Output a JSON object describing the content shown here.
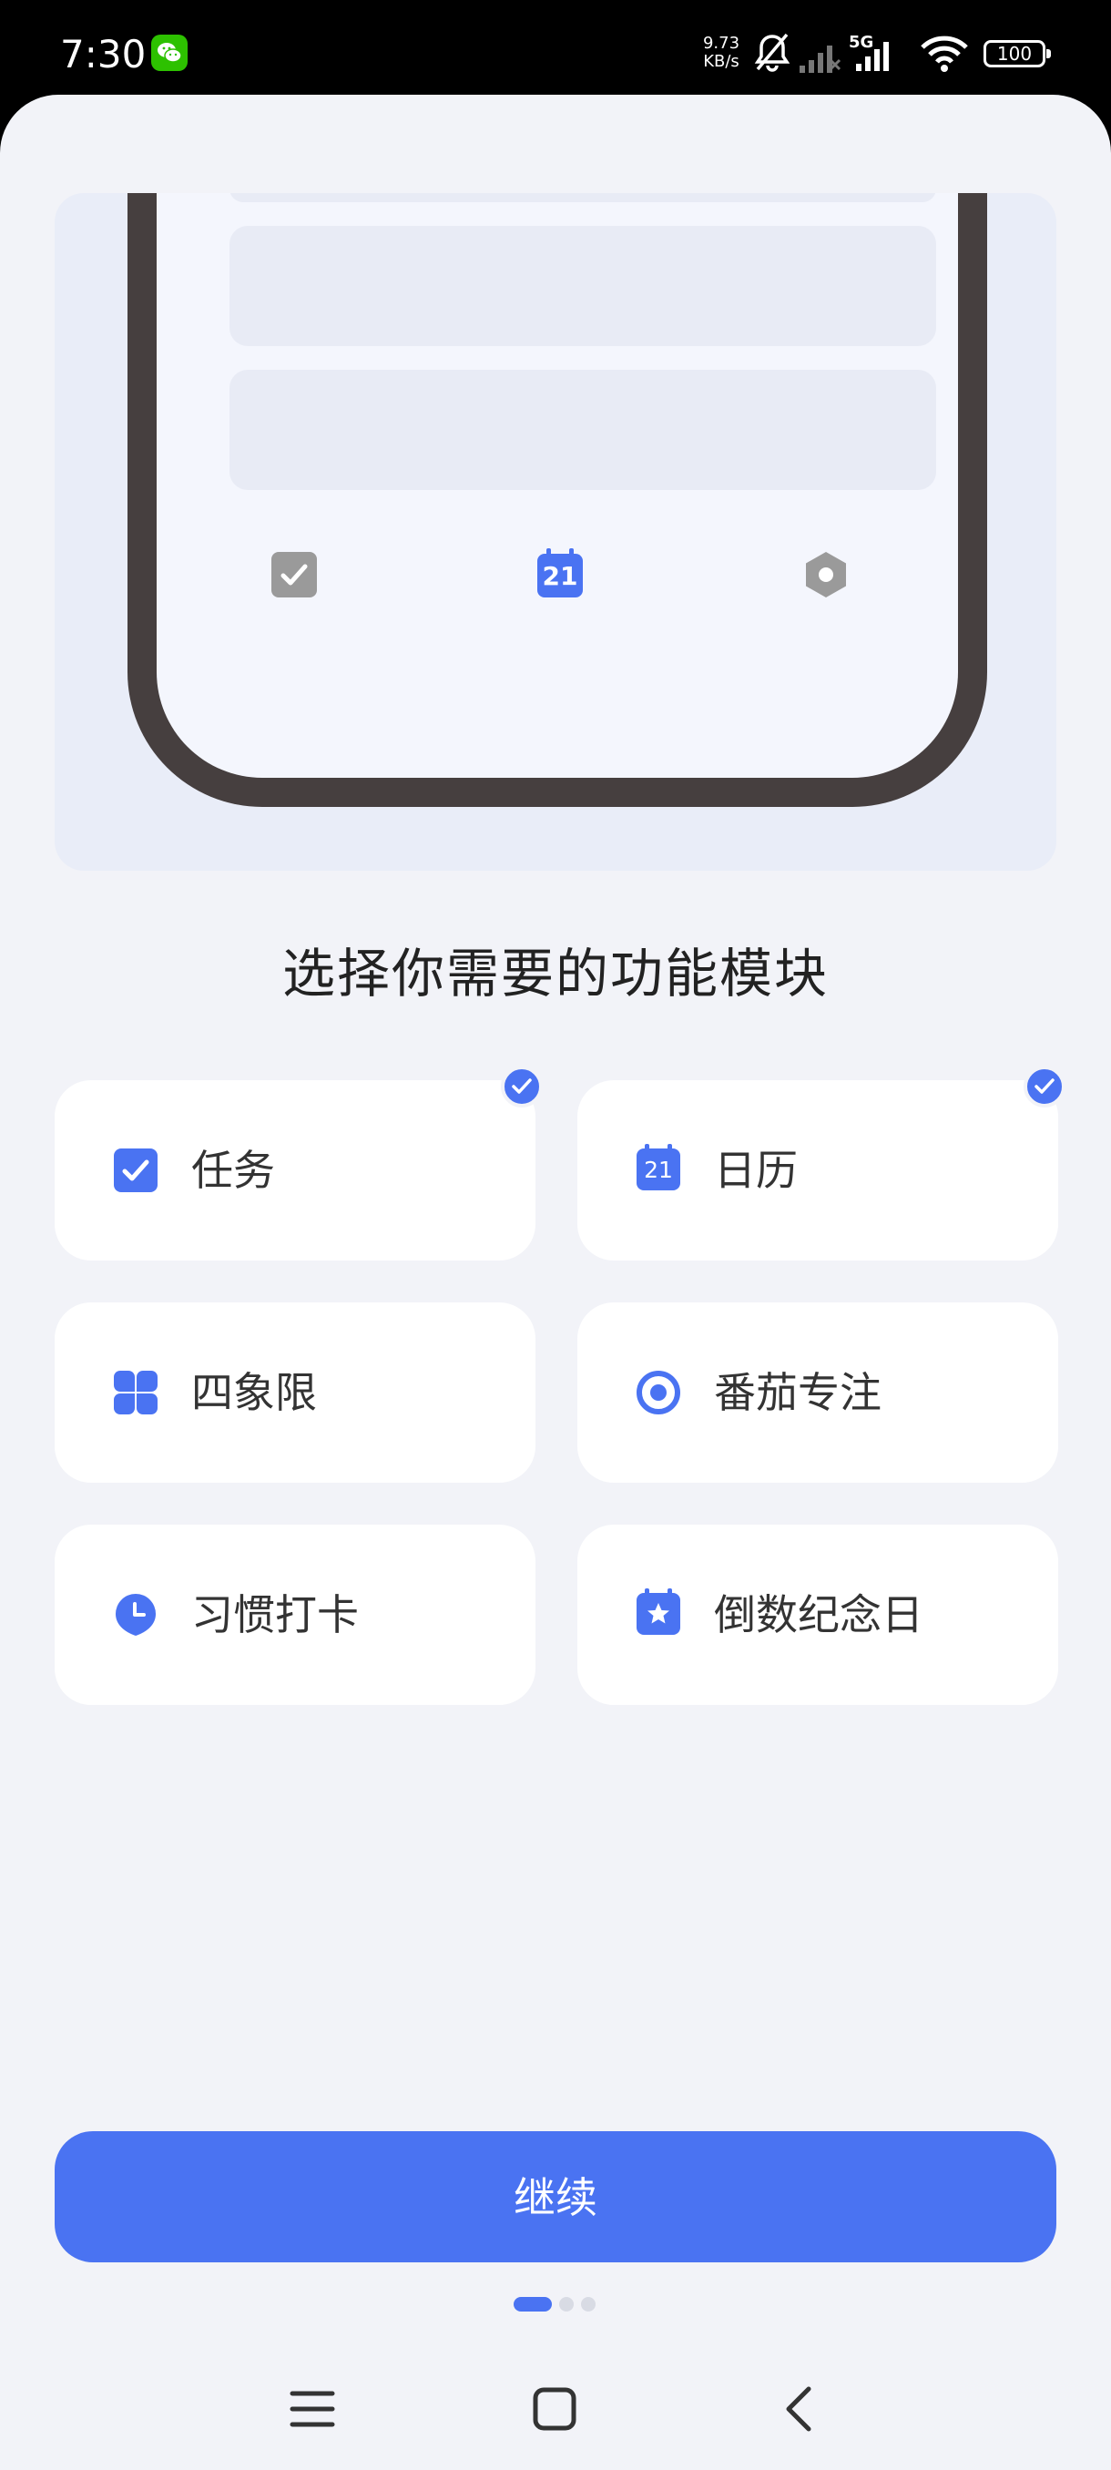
{
  "status_bar": {
    "time": "7:30",
    "net_speed_value": "9.73",
    "net_speed_unit": "KB/s",
    "network_type": "5G",
    "battery": "100",
    "icons": [
      "wechat-icon",
      "mute-bell-icon",
      "no-signal-icon",
      "signal-icon",
      "wifi-icon",
      "battery-icon"
    ]
  },
  "hero": {
    "calendar_day": "21",
    "tab_icons": [
      "checkbox-icon",
      "calendar-icon",
      "settings-icon"
    ]
  },
  "title": "选择你需要的功能模块",
  "modules": [
    {
      "label": "任务",
      "icon": "task-checkbox-icon",
      "selected": true
    },
    {
      "label": "日历",
      "icon": "calendar-icon",
      "selected": true,
      "icon_text": "21"
    },
    {
      "label": "四象限",
      "icon": "four-quadrant-icon",
      "selected": false
    },
    {
      "label": "番茄专注",
      "icon": "pomodoro-icon",
      "selected": false
    },
    {
      "label": "习惯打卡",
      "icon": "habit-clock-icon",
      "selected": false
    },
    {
      "label": "倒数纪念日",
      "icon": "countdown-star-icon",
      "selected": false
    }
  ],
  "continue_label": "继续",
  "pager": {
    "current": 1,
    "total": 3
  },
  "colors": {
    "accent": "#4a73f2",
    "background": "#f2f3f8",
    "card": "#ffffff",
    "frame": "#463f3f"
  }
}
